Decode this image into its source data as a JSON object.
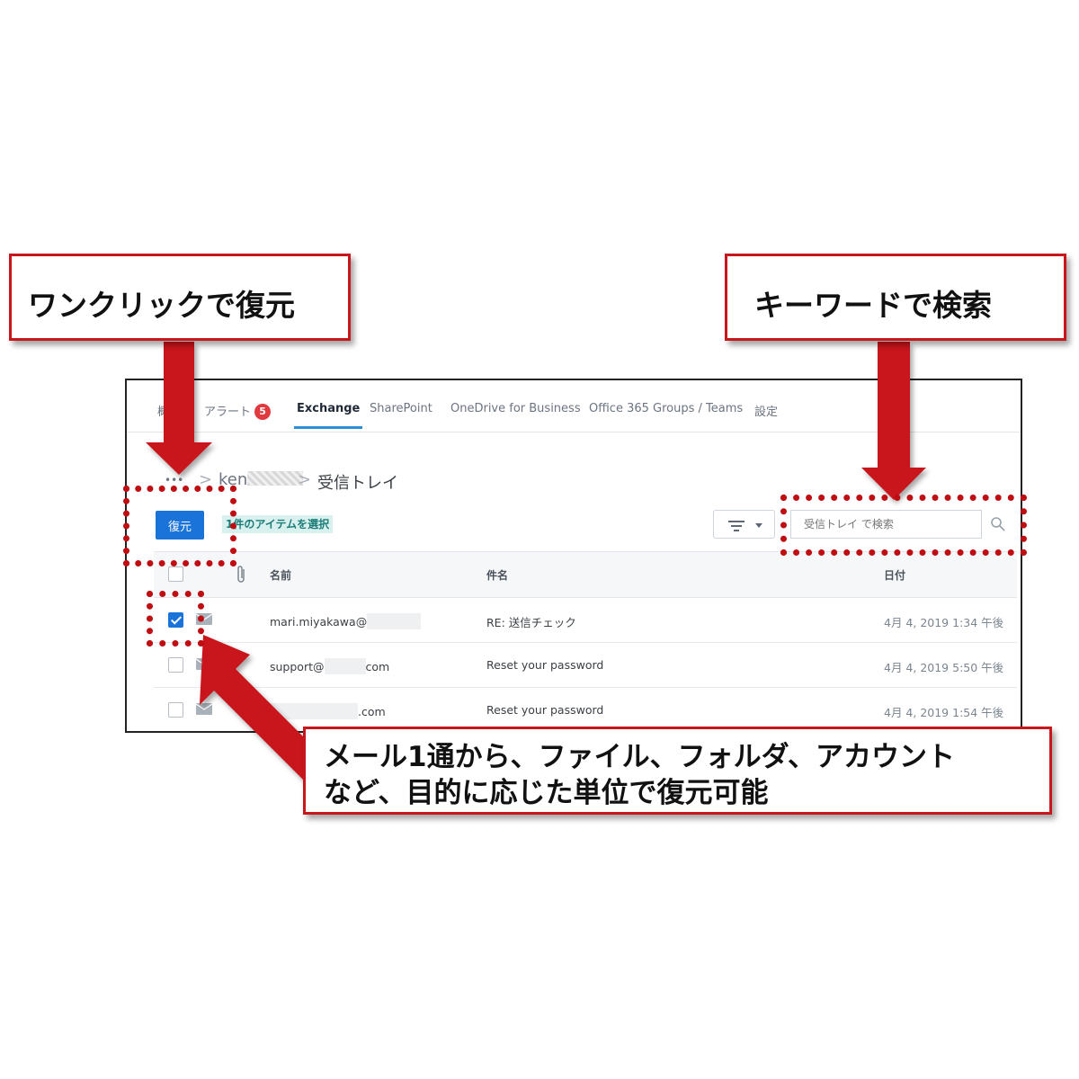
{
  "tabs": [
    {
      "label": "概",
      "active": false
    },
    {
      "label": "アラート",
      "badge": "5",
      "active": false
    },
    {
      "label": "Exchange",
      "active": true
    },
    {
      "label": "SharePoint",
      "active": false
    },
    {
      "label": "OneDrive for Business",
      "active": false
    },
    {
      "label": "Office 365 Groups / Teams",
      "active": false
    },
    {
      "label": "設定",
      "active": false
    }
  ],
  "breadcrumb": {
    "more": "•••",
    "separator": ">",
    "user": "ken",
    "folder": "受信トレイ"
  },
  "toolbar": {
    "restore_label": "復元",
    "selection_info": "1件のアイテムを選択",
    "search_placeholder": "受信トレイ で検索"
  },
  "table": {
    "columns": {
      "name": "名前",
      "subject": "件名",
      "date": "日付"
    },
    "rows": [
      {
        "checked": true,
        "name_prefix": "mari.miyakawa@",
        "name_suffix": "",
        "subject": "RE: 送信チェック",
        "date": "4月 4, 2019 1:34 午後"
      },
      {
        "checked": false,
        "name_prefix": "support@",
        "name_suffix": "com",
        "subject": "Reset your password",
        "date": "4月 4, 2019 5:50 午後"
      },
      {
        "checked": false,
        "name_prefix": "",
        "name_suffix": ".com",
        "subject": "Reset your password",
        "date": "4月 4, 2019 1:54 午後"
      }
    ]
  },
  "annotations": {
    "restore": "ワンクリックで復元",
    "search": "キーワードで検索",
    "granularity_line1": "メール1通から、ファイル、フォルダ、アカウント",
    "granularity_line2": "など、目的に応じた単位で復元可能"
  },
  "colors": {
    "accent": "#1a73d9",
    "tab_underline": "#2a8fd8",
    "badge": "#e0393e",
    "annotation_red": "#c8161d"
  }
}
